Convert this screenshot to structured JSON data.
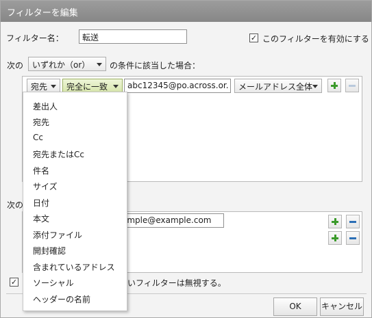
{
  "dialog": {
    "title": "フィルターを編集",
    "name_label": "フィルター名：",
    "name_value": "転送",
    "enable_label": "このフィルターを有効にする",
    "enable_checked": true,
    "cond_prefix": "次の",
    "match_mode": "いずれか（or）",
    "cond_suffix": "の条件に該当した場合：",
    "rule": {
      "field": "宛先",
      "operator": "完全に一致",
      "value": "abc12345@po.across.or.",
      "scope": "メールアドレス全体"
    },
    "action_label_visible": "次の",
    "action_value_visible": "ample@example.com",
    "ignore_checked": true,
    "ignore_text_visible": "低いフィルターは無視する。",
    "ok_label": "OK",
    "cancel_label": "キャンセル"
  },
  "menu": {
    "items": [
      "差出人",
      "宛先",
      "Cc",
      "宛先またはCc",
      "件名",
      "サイズ",
      "日付",
      "本文",
      "添付ファイル",
      "開封確認",
      "含まれているアドレス",
      "ソーシャル",
      "ヘッダーの名前"
    ]
  },
  "colors": {
    "titlebar": "#8e8e8e",
    "plus": "#3a9a2a",
    "minus": "#2b6fb6",
    "operator_bg": "#dfe9b9"
  }
}
